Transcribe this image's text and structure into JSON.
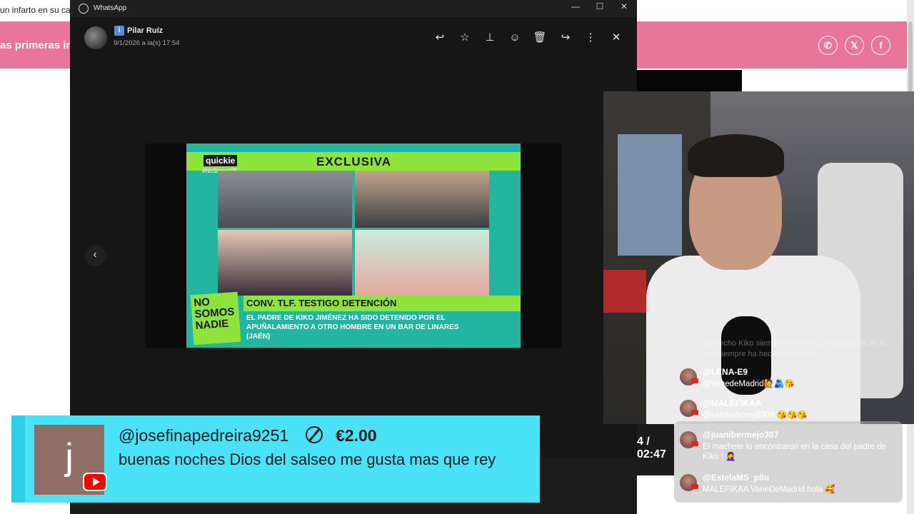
{
  "background_page": {
    "headline_fragment": "un infarto en su ca",
    "pink_banner_fragment": "as primeras im",
    "share_icons": [
      "whatsapp-icon",
      "x-icon",
      "facebook-icon"
    ],
    "share_glyphs": [
      "✆",
      "𝕏",
      "f"
    ],
    "overlay_fragment": "4 / 02:47"
  },
  "whatsapp": {
    "app_title": "WhatsApp",
    "window_controls": [
      "—",
      "☐",
      "✕"
    ],
    "sender_name": "Pilar Ruíz",
    "sender_badge": "i",
    "datetime": "9/1/2026 a la(s) 17:54",
    "toolbar_glyphs": {
      "reply": "↩",
      "star": "☆",
      "pin": "⊥",
      "react": "☺",
      "delete": "🗑",
      "forward": "↪",
      "more": "⋮",
      "close": "✕"
    },
    "nav_prev": "‹"
  },
  "tv": {
    "brand": "quickie",
    "hashtag": "#NoSomos9E",
    "banner": "EXCLUSIVA",
    "strip_title": "CONV. TLF. TESTIGO DETENCIÓN",
    "strip_body": "EL PADRE DE KIKO JIMÉNEZ HA SIDO DETENIDO POR EL APUÑALAMIENTO A OTRO HOMBRE EN UN BAR DE LINARES (JAÉN)",
    "logo": "NO SOMOS NADIE"
  },
  "chat": {
    "faded_message": "De hecho Kiko siempre ha dicho que su abuelo es el que siempre ha hecho de padre",
    "messages": [
      {
        "author": "@LENA-E9",
        "text": "@VanedeMadrid🙋🫂😘"
      },
      {
        "author": "@MALEFIKAA",
        "text": "@sandrabomy8309 😘😘😘"
      },
      {
        "author": "@juanibermejo307",
        "text": "El machete lo encontraron en la casa del padre de Kiko ! 🤦‍♀️"
      },
      {
        "author": "@EstelaMS_p8u",
        "text": "MALEFIKAA VaneDeMadrid hola 🥰"
      }
    ]
  },
  "superchat": {
    "avatar_letter": "j",
    "username": "@josefinapedreira9251",
    "amount": "€2.00",
    "message": "buenas noches Dios del salseo me gusta mas que rey",
    "color": "#49e2f6"
  }
}
